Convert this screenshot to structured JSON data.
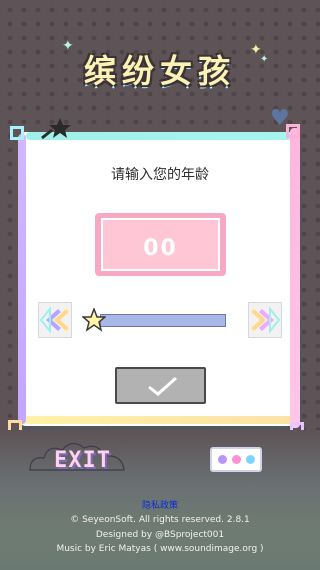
{
  "game": {
    "title": "缤纷女孩",
    "prompt": "请输入您的年龄",
    "age_value": "00",
    "slider_level": 0.0,
    "exit_label": "EXIT"
  },
  "footer": {
    "privacy": "隐私政策",
    "copyright": "© SeyeonSoft. All rights reserved.   2.8.1",
    "designed": "Designed by @BSproject001",
    "music": "Music by Eric Matyas ( www.soundimage.org )"
  },
  "colors": {
    "background": "#5e5356",
    "panel": "#ffffff",
    "age_box": "#f7a9c4",
    "slider": "#a9b6e8",
    "confirm": "#b2b2b2",
    "privacy_link": "#0b2bd6"
  },
  "icons": [
    "star-icon",
    "heart-icon",
    "left-arrow-icon",
    "right-arrow-icon",
    "checkmark-icon",
    "slider-star-knob-icon"
  ]
}
